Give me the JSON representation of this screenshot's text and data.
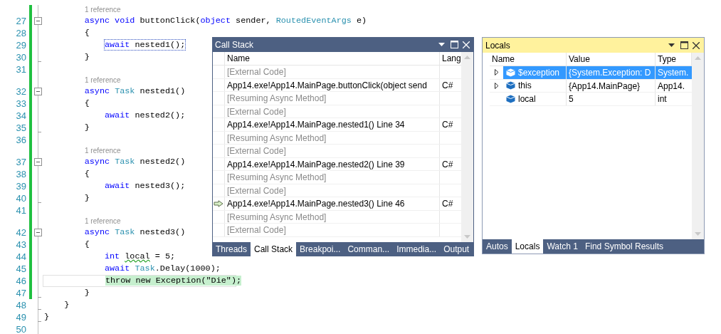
{
  "editor": {
    "lines": [
      {
        "kind": "reference",
        "text": "1 reference",
        "changed": true
      },
      {
        "kind": "code",
        "number": "27",
        "changed": true,
        "collapsible": true,
        "tokens": [
          {
            "text": "        async void",
            "kind": "keyword"
          },
          {
            "text": " buttonClick(",
            "kind": "plain"
          },
          {
            "text": "object",
            "kind": "keyword"
          },
          {
            "text": " sender, ",
            "kind": "plain"
          },
          {
            "text": "RoutedEventArgs",
            "kind": "type"
          },
          {
            "text": " e)",
            "kind": "plain"
          }
        ]
      },
      {
        "kind": "code",
        "number": "28",
        "changed": true,
        "tokens": [
          {
            "text": "        {",
            "kind": "plain"
          }
        ]
      },
      {
        "kind": "call_site",
        "number": "29",
        "changed": true,
        "tokens": [
          {
            "text": "            await",
            "kind": "keyword"
          },
          {
            "text": " nested1();",
            "kind": "plain"
          }
        ]
      },
      {
        "kind": "code",
        "number": "30",
        "changed": true,
        "block_end": true,
        "tokens": [
          {
            "text": "        }",
            "kind": "plain"
          }
        ]
      },
      {
        "kind": "code",
        "number": "31",
        "changed": true
      },
      {
        "kind": "reference",
        "text": "1 reference",
        "changed": true
      },
      {
        "kind": "code",
        "number": "32",
        "changed": true,
        "collapsible": true,
        "tokens": [
          {
            "text": "        async ",
            "kind": "keyword"
          },
          {
            "text": "Task",
            "kind": "type"
          },
          {
            "text": " nested1()",
            "kind": "plain"
          }
        ]
      },
      {
        "kind": "code",
        "number": "33",
        "changed": true,
        "tokens": [
          {
            "text": "        {",
            "kind": "plain"
          }
        ]
      },
      {
        "kind": "code",
        "number": "34",
        "changed": true,
        "tokens": [
          {
            "text": "            await",
            "kind": "keyword"
          },
          {
            "text": " nested2();",
            "kind": "plain"
          }
        ]
      },
      {
        "kind": "code",
        "number": "35",
        "changed": true,
        "block_end": true,
        "tokens": [
          {
            "text": "        }",
            "kind": "plain"
          }
        ]
      },
      {
        "kind": "code",
        "number": "36",
        "changed": true
      },
      {
        "kind": "reference",
        "text": "1 reference",
        "changed": true
      },
      {
        "kind": "code",
        "number": "37",
        "changed": true,
        "collapsible": true,
        "tokens": [
          {
            "text": "        async ",
            "kind": "keyword"
          },
          {
            "text": "Task",
            "kind": "type"
          },
          {
            "text": " nested2()",
            "kind": "plain"
          }
        ]
      },
      {
        "kind": "code",
        "number": "38",
        "changed": true,
        "tokens": [
          {
            "text": "        {",
            "kind": "plain"
          }
        ]
      },
      {
        "kind": "code",
        "number": "39",
        "changed": true,
        "tokens": [
          {
            "text": "            await",
            "kind": "keyword"
          },
          {
            "text": " nested3();",
            "kind": "plain"
          }
        ]
      },
      {
        "kind": "code",
        "number": "40",
        "changed": true,
        "block_end": true,
        "tokens": [
          {
            "text": "        }",
            "kind": "plain"
          }
        ]
      },
      {
        "kind": "code",
        "number": "41",
        "changed": true
      },
      {
        "kind": "reference",
        "text": "1 reference",
        "changed": true
      },
      {
        "kind": "code",
        "number": "42",
        "changed": true,
        "collapsible": true,
        "tokens": [
          {
            "text": "        async ",
            "kind": "keyword"
          },
          {
            "text": "Task",
            "kind": "type"
          },
          {
            "text": " nested3()",
            "kind": "plain"
          }
        ]
      },
      {
        "kind": "code",
        "number": "43",
        "changed": true,
        "tokens": [
          {
            "text": "        {",
            "kind": "plain"
          }
        ]
      },
      {
        "kind": "code",
        "number": "44",
        "changed": true,
        "tokens": [
          {
            "text": "            int ",
            "kind": "keyword"
          },
          {
            "text": "local",
            "kind": "plain",
            "squiggle": true
          },
          {
            "text": " = 5;",
            "kind": "plain"
          }
        ]
      },
      {
        "kind": "code",
        "number": "45",
        "changed": true,
        "tokens": [
          {
            "text": "            await ",
            "kind": "keyword"
          },
          {
            "text": "Task",
            "kind": "type"
          },
          {
            "text": ".Delay(1000);",
            "kind": "plain"
          }
        ]
      },
      {
        "kind": "current_statement",
        "number": "46",
        "changed": true,
        "tokens": [
          {
            "text": "            throw new Exception(\"Die\");",
            "kind": "plain"
          }
        ]
      },
      {
        "kind": "code",
        "number": "47",
        "changed": true,
        "block_end": true,
        "tokens": [
          {
            "text": "        }",
            "kind": "plain"
          }
        ]
      },
      {
        "kind": "code",
        "number": "48",
        "changed": false,
        "block_end": true,
        "tokens": [
          {
            "text": "    }",
            "kind": "plain"
          }
        ]
      },
      {
        "kind": "code",
        "number": "49",
        "changed": false,
        "block_end": true,
        "tokens": [
          {
            "text": "}",
            "kind": "plain"
          }
        ]
      },
      {
        "kind": "code",
        "number": "50",
        "changed": false
      }
    ]
  },
  "call_stack": {
    "title": "Call Stack",
    "columns": [
      "Name",
      "Lang"
    ],
    "rows": [
      {
        "kind": "external",
        "name": "[External Code]",
        "current": false
      },
      {
        "kind": "frame",
        "name": "App14.exe!App14.MainPage.buttonClick(object send",
        "language": "C#",
        "current": false
      },
      {
        "kind": "external",
        "name": "[Resuming Async Method]",
        "current": false
      },
      {
        "kind": "external",
        "name": "[External Code]",
        "current": false
      },
      {
        "kind": "frame",
        "name": "App14.exe!App14.MainPage.nested1() Line 34",
        "language": "C#",
        "current": false
      },
      {
        "kind": "external",
        "name": "[Resuming Async Method]",
        "current": false
      },
      {
        "kind": "external",
        "name": "[External Code]",
        "current": false
      },
      {
        "kind": "frame",
        "name": "App14.exe!App14.MainPage.nested2() Line 39",
        "language": "C#",
        "current": false
      },
      {
        "kind": "external",
        "name": "[Resuming Async Method]",
        "current": false
      },
      {
        "kind": "external",
        "name": "[External Code]",
        "current": false
      },
      {
        "kind": "frame",
        "name": "App14.exe!App14.MainPage.nested3() Line 46",
        "language": "C#",
        "current": true
      },
      {
        "kind": "external",
        "name": "[Resuming Async Method]",
        "current": false
      },
      {
        "kind": "external",
        "name": "[External Code]",
        "current": false
      }
    ],
    "tabs": [
      {
        "label": "Threads",
        "selected": false
      },
      {
        "label": "Call Stack",
        "selected": true
      },
      {
        "label": "Breakpoi...",
        "selected": false
      },
      {
        "label": "Comman...",
        "selected": false
      },
      {
        "label": "Immedia...",
        "selected": false
      },
      {
        "label": "Output",
        "selected": false
      }
    ]
  },
  "locals": {
    "title": "Locals",
    "columns": [
      "Name",
      "Value",
      "Type"
    ],
    "rows": [
      {
        "name": "$exception",
        "value": "{System.Exception: D",
        "type": "System.",
        "expandable": true,
        "selected": true
      },
      {
        "name": "this",
        "value": "{App14.MainPage}",
        "type": "App14.",
        "expandable": true,
        "selected": false
      },
      {
        "name": "local",
        "value": "5",
        "type": "int",
        "expandable": false,
        "selected": false
      }
    ],
    "tabs": [
      {
        "label": "Autos",
        "selected": false
      },
      {
        "label": "Locals",
        "selected": true
      },
      {
        "label": "Watch 1",
        "selected": false
      },
      {
        "label": "Find Symbol Results",
        "selected": false
      }
    ]
  }
}
